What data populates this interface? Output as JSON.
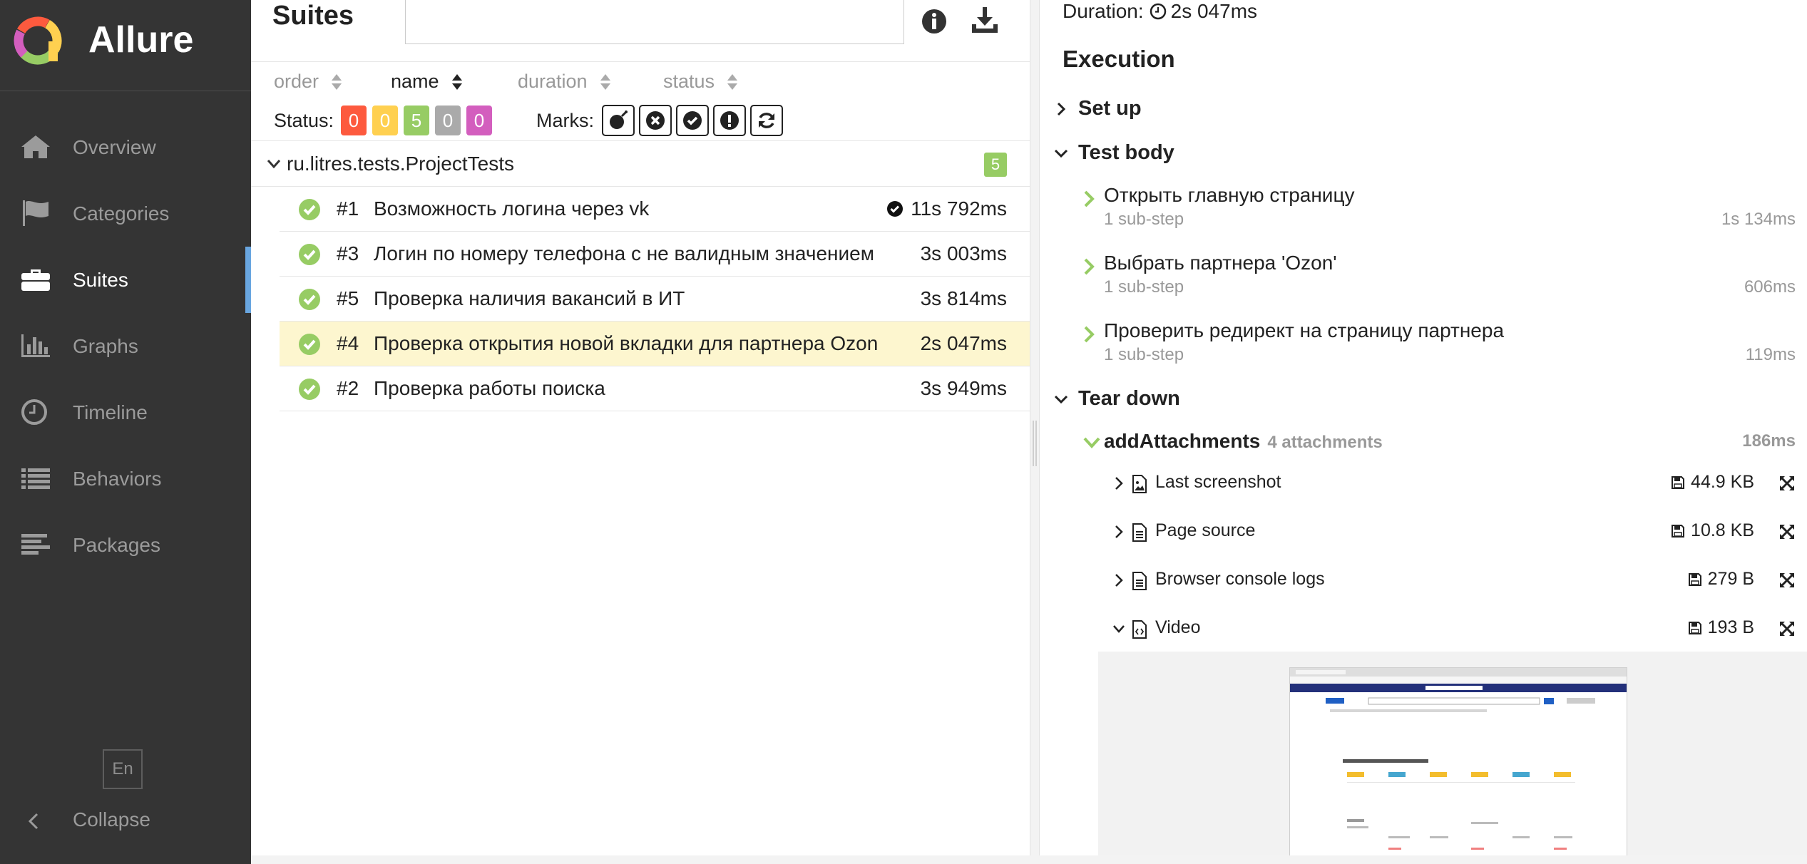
{
  "app": {
    "name": "Allure"
  },
  "sidebar": {
    "items": [
      {
        "label": "Overview",
        "icon": "home-icon"
      },
      {
        "label": "Categories",
        "icon": "flag-icon"
      },
      {
        "label": "Suites",
        "icon": "briefcase-icon",
        "active": true
      },
      {
        "label": "Graphs",
        "icon": "bar-chart-icon"
      },
      {
        "label": "Timeline",
        "icon": "clock-icon"
      },
      {
        "label": "Behaviors",
        "icon": "list-icon"
      },
      {
        "label": "Packages",
        "icon": "align-left-icon"
      }
    ],
    "language": "En",
    "collapse_label": "Collapse"
  },
  "suites": {
    "title": "Suites",
    "search_value": "",
    "sort": {
      "order": "order",
      "name": "name",
      "duration": "duration",
      "status": "status",
      "active": "name"
    },
    "status_label": "Status:",
    "status_counts": [
      {
        "value": "0",
        "status": "failed",
        "color": "#fd5a3e"
      },
      {
        "value": "0",
        "status": "broken",
        "color": "#ffd050"
      },
      {
        "value": "5",
        "status": "passed",
        "color": "#97cc64"
      },
      {
        "value": "0",
        "status": "skipped",
        "color": "#aaaaaa"
      },
      {
        "value": "0",
        "status": "unknown",
        "color": "#d35ebe"
      }
    ],
    "marks_label": "Marks:",
    "marks": [
      "bomb-icon",
      "times-circle-icon",
      "check-circle-icon",
      "exclamation-circle-icon",
      "refresh-icon"
    ],
    "group": {
      "name": "ru.litres.tests.ProjectTests",
      "count": "5"
    },
    "tests": [
      {
        "num": "#1",
        "name": "Возможность логина через vk",
        "duration": "11s 792ms",
        "flaky": true
      },
      {
        "num": "#3",
        "name": "Логин по номеру телефона с не валидным значением",
        "duration": "3s 003ms"
      },
      {
        "num": "#5",
        "name": "Проверка наличия вакансий в ИТ",
        "duration": "3s 814ms"
      },
      {
        "num": "#4",
        "name": "Проверка открытия новой вкладки для партнера Ozon",
        "duration": "2s 047ms",
        "selected": true
      },
      {
        "num": "#2",
        "name": "Проверка работы поиска",
        "duration": "3s 949ms"
      }
    ]
  },
  "detail": {
    "duration_label": "Duration:",
    "duration_value": "2s 047ms",
    "execution_title": "Execution",
    "setup_label": "Set up",
    "body_label": "Test body",
    "steps": [
      {
        "name": "Открыть главную страницу",
        "sub": "1 sub-step",
        "duration": "1s 134ms"
      },
      {
        "name": "Выбрать партнера 'Ozon'",
        "sub": "1 sub-step",
        "duration": "606ms"
      },
      {
        "name": "Проверить редирект на страницу партнера",
        "sub": "1 sub-step",
        "duration": "119ms"
      }
    ],
    "teardown_label": "Tear down",
    "attachment_step": {
      "name": "addAttachments",
      "count": "4 attachments",
      "duration": "186ms"
    },
    "attachments": [
      {
        "name": "Last screenshot",
        "size": "44.9 KB",
        "icon": "image-file-icon"
      },
      {
        "name": "Page source",
        "size": "10.8 KB",
        "icon": "text-file-icon"
      },
      {
        "name": "Browser console logs",
        "size": "279 B",
        "icon": "text-file-icon"
      },
      {
        "name": "Video",
        "size": "193 B",
        "icon": "code-file-icon",
        "expanded": true
      }
    ]
  }
}
